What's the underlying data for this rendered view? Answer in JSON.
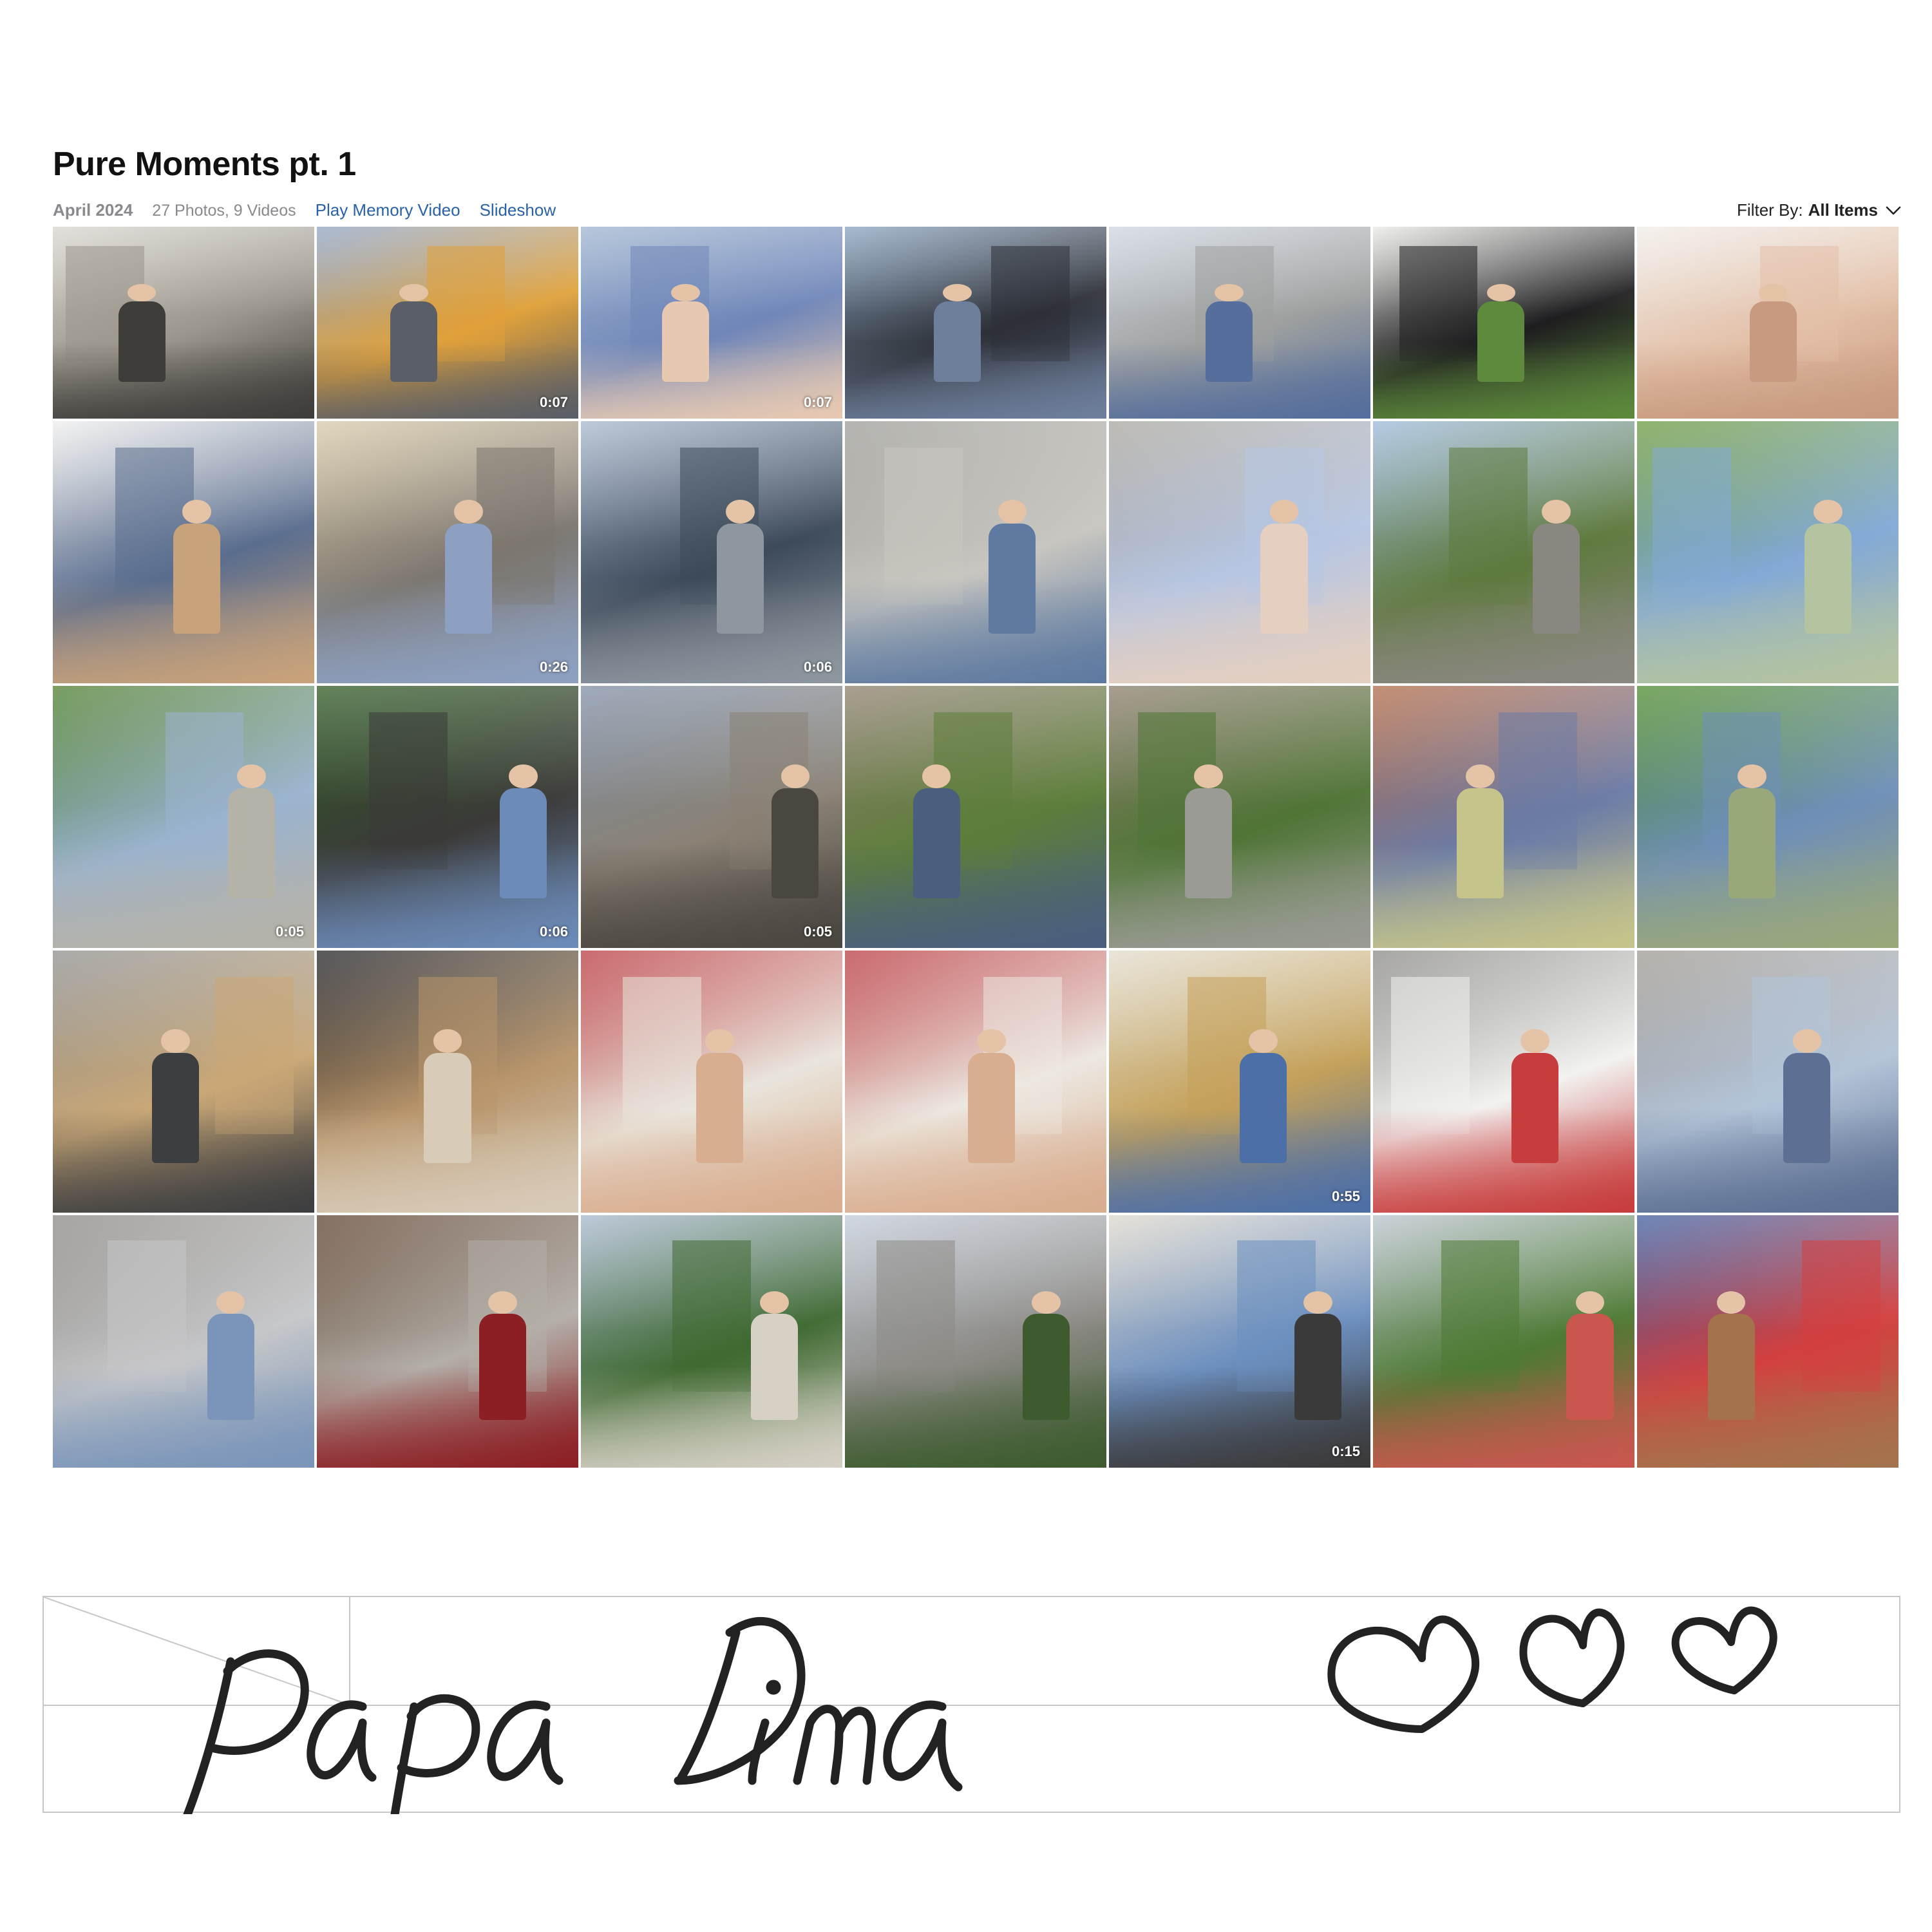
{
  "album": {
    "title": "Pure Moments pt. 1",
    "date": "April 2024",
    "counts": "27 Photos, 9 Videos",
    "play_memory_label": "Play Memory Video",
    "slideshow_label": "Slideshow",
    "filter_label": "Filter By:",
    "filter_value": "All Items"
  },
  "photos": [
    {
      "duration": "",
      "palette": [
        "#d9d6cf",
        "#9a958b",
        "#3e3d3a"
      ]
    },
    {
      "duration": "0:07",
      "palette": [
        "#8fa4c4",
        "#e0a13a",
        "#5a5e66"
      ]
    },
    {
      "duration": "0:07",
      "palette": [
        "#9fb4cf",
        "#6f86b8",
        "#e7c9b2"
      ]
    },
    {
      "duration": "",
      "palette": [
        "#8aa3c0",
        "#2d3036",
        "#6e7f9c"
      ]
    },
    {
      "duration": "",
      "palette": [
        "#cfd6e0",
        "#9ea09f",
        "#556e9c"
      ]
    },
    {
      "duration": "",
      "palette": [
        "#e9e9e6",
        "#1e1d1f",
        "#5d8a3c"
      ]
    },
    {
      "duration": "",
      "palette": [
        "#f1ede8",
        "#e3c0a8",
        "#c89a80"
      ]
    },
    {
      "duration": "",
      "palette": [
        "#eeeeed",
        "#5a6d8e",
        "#c8a27a"
      ]
    },
    {
      "duration": "0:26",
      "palette": [
        "#d8c9a8",
        "#7c7770",
        "#8da0c1"
      ]
    },
    {
      "duration": "0:06",
      "palette": [
        "#a8b7cc",
        "#3d4a5a",
        "#8e979f"
      ]
    },
    {
      "duration": "",
      "palette": [
        "#9c9b96",
        "#c8c6c0",
        "#5e7aa0"
      ]
    },
    {
      "duration": "",
      "palette": [
        "#a8a59e",
        "#b7c6e3",
        "#e4cfc0"
      ]
    },
    {
      "duration": "",
      "palette": [
        "#9db9d8",
        "#5f7a3e",
        "#8a8780"
      ]
    },
    {
      "duration": "",
      "palette": [
        "#6b9a3e",
        "#83a9d6",
        "#b5c4a0"
      ]
    },
    {
      "duration": "0:05",
      "palette": [
        "#4d7d2f",
        "#9ab3cf",
        "#b5b2a8"
      ]
    },
    {
      "duration": "0:06",
      "palette": [
        "#2f5a24",
        "#3b3a38",
        "#6c8bb8"
      ]
    },
    {
      "duration": "0:05",
      "palette": [
        "#7e8da3",
        "#8a8275",
        "#4a4640"
      ]
    },
    {
      "duration": "",
      "palette": [
        "#8c7f6c",
        "#5d7e3a",
        "#4a5e7e"
      ]
    },
    {
      "duration": "",
      "palette": [
        "#8a7d6b",
        "#4f7535",
        "#9a9b94"
      ]
    },
    {
      "duration": "",
      "palette": [
        "#b06a47",
        "#6b7ba6",
        "#c5c48a"
      ]
    },
    {
      "duration": "",
      "palette": [
        "#4d8a2c",
        "#6f8fb8",
        "#99a87a"
      ]
    },
    {
      "duration": "",
      "palette": [
        "#8f8f8d",
        "#caa877",
        "#3d3e40"
      ]
    },
    {
      "duration": "",
      "palette": [
        "#222226",
        "#b8956b",
        "#d8cbb8"
      ]
    },
    {
      "duration": "",
      "palette": [
        "#b93b3f",
        "#e9e5dc",
        "#d9ad8f"
      ]
    },
    {
      "duration": "",
      "palette": [
        "#b93b3f",
        "#ece8e0",
        "#d9ad8f"
      ]
    },
    {
      "duration": "0:55",
      "palette": [
        "#e2dccd",
        "#c4a15a",
        "#4c6fa8"
      ]
    },
    {
      "duration": "",
      "palette": [
        "#8b8a86",
        "#f2f2f0",
        "#c73c3c"
      ]
    },
    {
      "duration": "",
      "palette": [
        "#9e9891",
        "#b3c4d8",
        "#5d6f92"
      ]
    },
    {
      "duration": "",
      "palette": [
        "#8a8782",
        "#c6c7c9",
        "#7a95b9"
      ]
    },
    {
      "duration": "",
      "palette": [
        "#5e4230",
        "#b3afa7",
        "#8c1f24"
      ]
    },
    {
      "duration": "",
      "palette": [
        "#a7b7cc",
        "#3f6a32",
        "#d6d0c5"
      ]
    },
    {
      "duration": "",
      "palette": [
        "#c2cad6",
        "#8c8a85",
        "#3d5b2e"
      ]
    },
    {
      "duration": "0:15",
      "palette": [
        "#dcd7cc",
        "#6c8fbf",
        "#3b3a3a"
      ]
    },
    {
      "duration": "",
      "palette": [
        "#b9c3cc",
        "#4d7a33",
        "#c9574e"
      ]
    },
    {
      "duration": "",
      "palette": [
        "#3d5ea0",
        "#d3403f",
        "#a4734c"
      ]
    }
  ],
  "note": {
    "handwritten_text": "Papa Dima",
    "hearts_icon": "heart-icon",
    "ink_color": "#222222"
  },
  "colors": {
    "accent": "#2a62a8",
    "selection": "#2a62a8"
  }
}
